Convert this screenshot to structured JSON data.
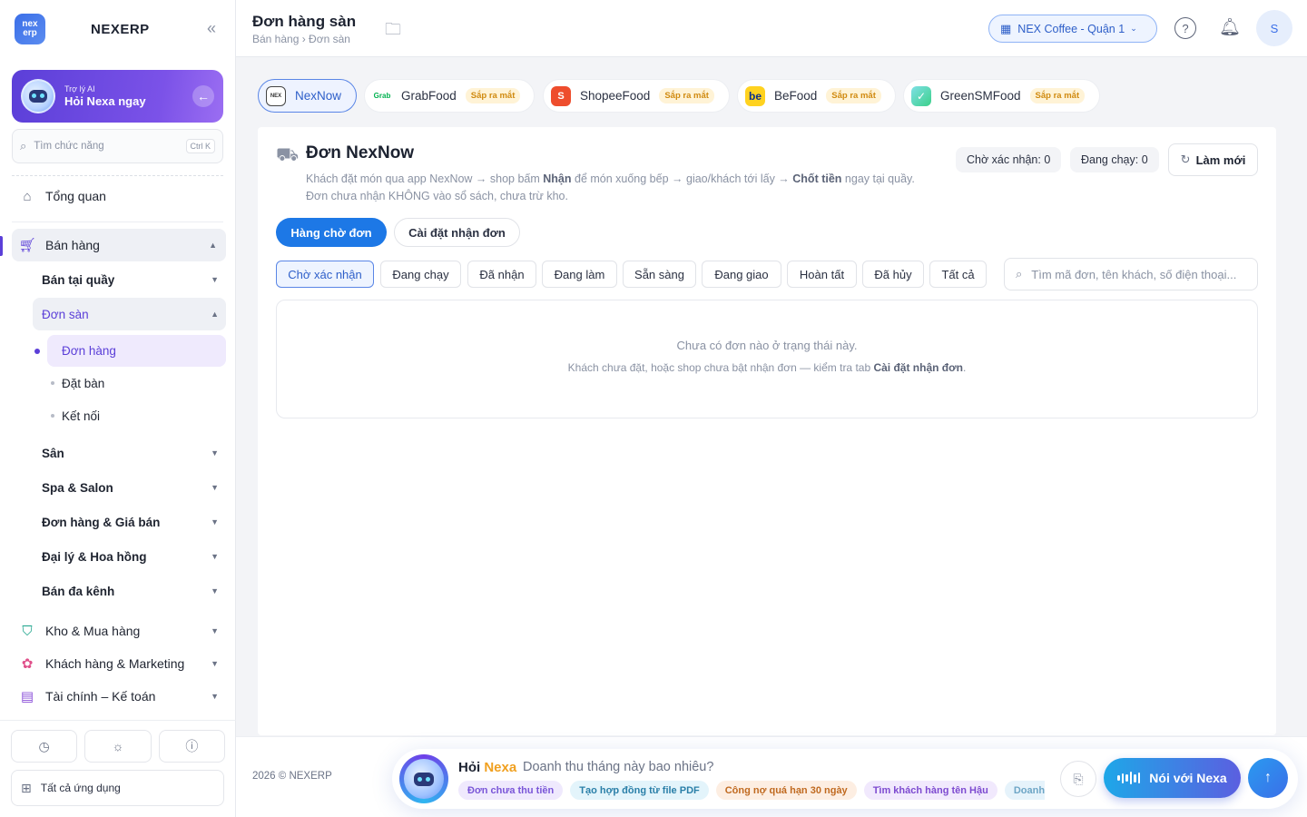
{
  "brand": {
    "logo_top": "nex",
    "logo_bottom": "erp",
    "name": "NEXERP",
    "collapse_icon": "«"
  },
  "ai_card": {
    "small": "Trợ lý AI",
    "big": "Hỏi Nexa ngay",
    "arrow": "←"
  },
  "side_search": {
    "placeholder": "Tìm chức năng",
    "shortcut": "Ctrl K",
    "icon": "⌕"
  },
  "nav": {
    "overview": "Tổng quan",
    "sales": "Bán hàng",
    "sales_counter": "Bán tại quầy",
    "platform_orders": "Đơn sàn",
    "orders": "Đơn hàng",
    "reservations": "Đặt bàn",
    "connections": "Kết nối",
    "yard": "Sân",
    "spa": "Spa & Salon",
    "orders_pricing": "Đơn hàng & Giá bán",
    "agents": "Đại lý & Hoa hồng",
    "omnichannel": "Bán đa kênh",
    "inventory": "Kho & Mua hàng",
    "customers": "Khách hàng & Marketing",
    "finance": "Tài chính – Kế toán",
    "chevron_down": "▼",
    "chevron_up": "▲"
  },
  "all_apps": "Tất cả ứng dụng",
  "header": {
    "title": "Đơn hàng sàn",
    "breadcrumb": "Bán hàng › Đơn sàn",
    "store": "NEX Coffee - Quận 1",
    "user_initial": "S",
    "help": "?"
  },
  "platforms": [
    {
      "name": "NexNow",
      "soon": "",
      "logo": "NEX",
      "color": "#ffffff"
    },
    {
      "name": "GrabFood",
      "soon": "Sắp ra mắt",
      "logo": "Grab",
      "color": "#ffffff"
    },
    {
      "name": "ShopeeFood",
      "soon": "Sắp ra mắt",
      "logo": "S",
      "color": "#ee4d2d"
    },
    {
      "name": "BeFood",
      "soon": "Sắp ra mắt",
      "logo": "be",
      "color": "#ffd21f"
    },
    {
      "name": "GreenSMFood",
      "soon": "Sắp ra mắt",
      "logo": "✓",
      "color": "#3cd0d6"
    }
  ],
  "card": {
    "title": "Đơn NexNow",
    "desc_1a": "Khách đặt món qua app NexNow → shop bấm ",
    "desc_1b": "Nhận",
    "desc_1c": " để món xuống bếp → giao/khách tới lấy → ",
    "desc_1d": "Chốt tiền",
    "desc_1e": " ngay tại quầy.",
    "desc_2": "Đơn chưa nhận KHÔNG vào sổ sách, chưa trừ kho.",
    "stat_pending": "Chờ xác nhận: 0",
    "stat_running": "Đang chạy: 0",
    "refresh": "Làm mới",
    "seg_queue": "Hàng chờ đơn",
    "seg_settings": "Cài đặt nhận đơn",
    "filters": [
      "Chờ xác nhận",
      "Đang chạy",
      "Đã nhận",
      "Đang làm",
      "Sẵn sàng",
      "Đang giao",
      "Hoàn tất",
      "Đã hủy",
      "Tất cả"
    ],
    "search_placeholder": "Tìm mã đơn, tên khách, số điện thoại...",
    "empty_1": "Chưa có đơn nào ở trạng thái này.",
    "empty_2a": "Khách chưa đặt, hoặc shop chưa bật nhận đơn — kiểm tra tab ",
    "empty_2b": "Cài đặt nhận đơn",
    "empty_2c": "."
  },
  "footer": {
    "copyright": "2026 © NEXERP",
    "ask_prefix": "Hỏi ",
    "ask_brand": "Nexa",
    "ask_text": "Doanh thu tháng này bao nhiêu?",
    "suggestions": [
      {
        "text": "Đơn chưa thu tiền",
        "bg": "#efe9fd",
        "fg": "#7a56d8"
      },
      {
        "text": "Tạo hợp đồng từ file PDF",
        "bg": "#e3f4fb",
        "fg": "#2a7fa8"
      },
      {
        "text": "Công nợ quá hạn 30 ngày",
        "bg": "#fdeee2",
        "fg": "#c06a20"
      },
      {
        "text": "Tìm khách hàng tên Hậu",
        "bg": "#f1e9fd",
        "fg": "#7d4ad0"
      },
      {
        "text": "Doanh th",
        "bg": "#e6f3fb",
        "fg": "#6ea6c6"
      }
    ],
    "voice": "Nói với Nexa",
    "send": "↑"
  }
}
